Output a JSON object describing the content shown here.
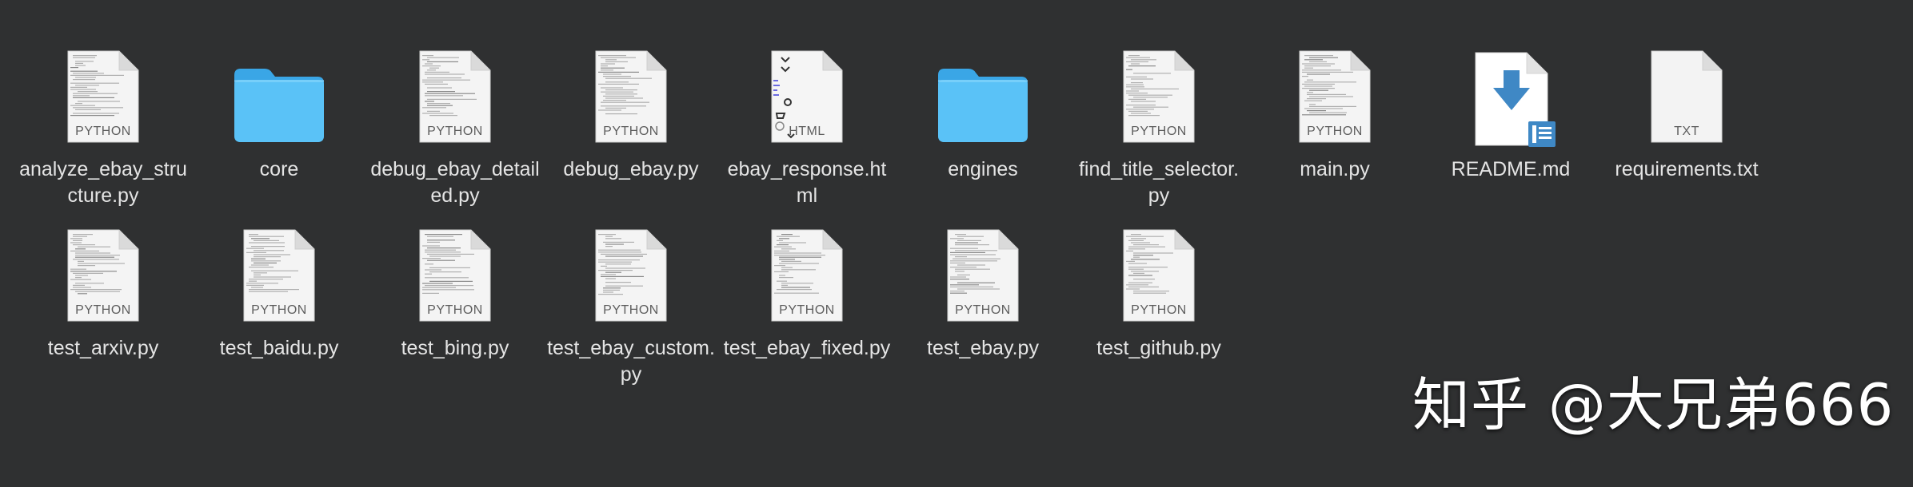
{
  "files": [
    {
      "name": "analyze_ebay_structure.py",
      "kind": "PYTHON",
      "icon": "python-file-icon"
    },
    {
      "name": "core",
      "kind": "",
      "icon": "folder-icon"
    },
    {
      "name": "debug_ebay_detailed.py",
      "kind": "PYTHON",
      "icon": "python-file-icon"
    },
    {
      "name": "debug_ebay.py",
      "kind": "PYTHON",
      "icon": "python-file-icon"
    },
    {
      "name": "ebay_response.html",
      "kind": "HTML",
      "icon": "html-file-icon"
    },
    {
      "name": "engines",
      "kind": "",
      "icon": "folder-icon"
    },
    {
      "name": "find_title_selector.py",
      "kind": "PYTHON",
      "icon": "python-file-icon"
    },
    {
      "name": "main.py",
      "kind": "PYTHON",
      "icon": "python-file-icon"
    },
    {
      "name": "README.md",
      "kind": "",
      "icon": "markdown-file-icon"
    },
    {
      "name": "requirements.txt",
      "kind": "TXT",
      "icon": "text-file-icon"
    },
    {
      "name": "test_arxiv.py",
      "kind": "PYTHON",
      "icon": "python-file-icon"
    },
    {
      "name": "test_baidu.py",
      "kind": "PYTHON",
      "icon": "python-file-icon"
    },
    {
      "name": "test_bing.py",
      "kind": "PYTHON",
      "icon": "python-file-icon"
    },
    {
      "name": "test_ebay_custom.py",
      "kind": "PYTHON",
      "icon": "python-file-icon"
    },
    {
      "name": "test_ebay_fixed.py",
      "kind": "PYTHON",
      "icon": "python-file-icon"
    },
    {
      "name": "test_ebay.py",
      "kind": "PYTHON",
      "icon": "python-file-icon"
    },
    {
      "name": "test_github.py",
      "kind": "PYTHON",
      "icon": "python-file-icon"
    }
  ],
  "watermark": "知乎 @大兄弟666",
  "colors": {
    "background": "#2f3031",
    "folder": "#5ac2f7",
    "label": "#e4e4e4",
    "readme_arrow": "#3f88c5"
  }
}
